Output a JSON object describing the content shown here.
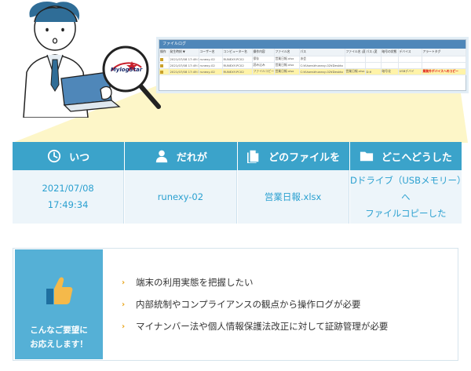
{
  "illustration": {
    "logo_text": "MylogStar",
    "log_window": {
      "title": "ファイルログ",
      "headers": [
        "操作",
        "発生時刻 ▼",
        "ユーザー名",
        "コンピューター名",
        "操作内容",
        "ファイル名",
        "パス",
        "ファイル名 (変",
        "パス (変",
        "暗号の状態",
        "デバイス",
        "アラートタグ"
      ],
      "rows": [
        [
          "",
          "2021/07/08 17:49:36",
          "runexy-02",
          "RUNEXY-PC02",
          "保存",
          "営業日報.xlsx",
          "あ会",
          "",
          "",
          "",
          "",
          ""
        ],
        [
          "",
          "2021/07/08 17:49:34",
          "runexy-02",
          "RUNEXY-PC02",
          "読み込み",
          "営業日報.xlsx",
          "C:¥Users¥runexy-02¥Deskto",
          "",
          "",
          "",
          "",
          ""
        ],
        [
          "",
          "2021/07/08 17:49:34",
          "runexy-02",
          "RUNEXY-PC02",
          "ファイルコピー",
          "営業日報.xlsx",
          "C:¥Users¥runexy-02¥Deskto",
          "営業日報.xlsx",
          "D:¥",
          "暗号化",
          "USBデバイ",
          "業務外デバイスへのコピー"
        ]
      ]
    }
  },
  "info": [
    {
      "icon": "clock-icon",
      "label": "いつ",
      "lines": [
        "2021/07/08",
        "17:49:34"
      ]
    },
    {
      "icon": "user-icon",
      "label": "だれが",
      "lines": [
        "runexy-02"
      ]
    },
    {
      "icon": "file-icon",
      "label": "どのファイルを",
      "lines": [
        "営業日報.xlsx"
      ]
    },
    {
      "icon": "folder-icon",
      "label": "どこへどうした",
      "lines": [
        "Dドライブ（USBメモリー）へ",
        "ファイルコピーした"
      ]
    }
  ],
  "request": {
    "card_lines": [
      "こんなご要望に",
      "お応えします！"
    ],
    "items": [
      "端末の利用実態を把握したい",
      "内部統制やコンプライアンスの観点から操作ログが必要",
      "マイナンバー法や個人情報保護法改正に対して証跡管理が必要"
    ]
  },
  "colors": {
    "accent": "#3ba3ca",
    "card": "#55b0d6",
    "highlight": "#fff3a8",
    "bullet": "#e8a317"
  }
}
